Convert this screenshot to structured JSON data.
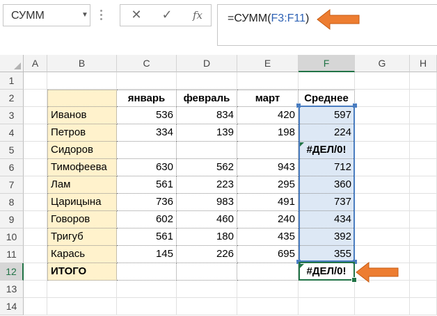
{
  "name_box": {
    "value": "СУММ"
  },
  "formula_bar": {
    "prefix": "=СУММ(",
    "range": "F3:F11",
    "suffix": ")",
    "cancel_glyph": "✕",
    "enter_glyph": "✓",
    "fx_label": "fx"
  },
  "columns": [
    "A",
    "B",
    "C",
    "D",
    "E",
    "F",
    "G",
    "H"
  ],
  "rows": [
    "1",
    "2",
    "3",
    "4",
    "5",
    "6",
    "7",
    "8",
    "9",
    "10",
    "11",
    "12",
    "13",
    "14"
  ],
  "table": {
    "headers": [
      "январь",
      "февраль",
      "март",
      "Среднее"
    ],
    "data": [
      {
        "name": "Иванов",
        "jan": "536",
        "feb": "834",
        "mar": "420",
        "avg": "597"
      },
      {
        "name": "Петров",
        "jan": "334",
        "feb": "139",
        "mar": "198",
        "avg": "224"
      },
      {
        "name": "Сидоров",
        "jan": "",
        "feb": "",
        "mar": "",
        "avg": "#ДЕЛ/0!"
      },
      {
        "name": "Тимофеева",
        "jan": "630",
        "feb": "562",
        "mar": "943",
        "avg": "712"
      },
      {
        "name": "Лам",
        "jan": "561",
        "feb": "223",
        "mar": "295",
        "avg": "360"
      },
      {
        "name": "Царицына",
        "jan": "736",
        "feb": "983",
        "mar": "491",
        "avg": "737"
      },
      {
        "name": "Говоров",
        "jan": "602",
        "feb": "460",
        "mar": "240",
        "avg": "434"
      },
      {
        "name": "Тригуб",
        "jan": "561",
        "feb": "180",
        "mar": "435",
        "avg": "392"
      },
      {
        "name": "Карась",
        "jan": "145",
        "feb": "226",
        "mar": "695",
        "avg": "355"
      }
    ],
    "total": {
      "label": "ИТОГО",
      "value": "#ДЕЛ/0!"
    }
  },
  "colors": {
    "name_fill": "#fff2cc",
    "range_fill": "#dde8f5",
    "range_border": "#4a7dc0",
    "active_border": "#217346",
    "arrow": "#ed7d31"
  },
  "icons": {
    "dropdown": "chevron-down-icon",
    "cancel": "close-icon",
    "enter": "check-icon",
    "function": "fx-icon",
    "callout": "arrow-left-icon"
  }
}
